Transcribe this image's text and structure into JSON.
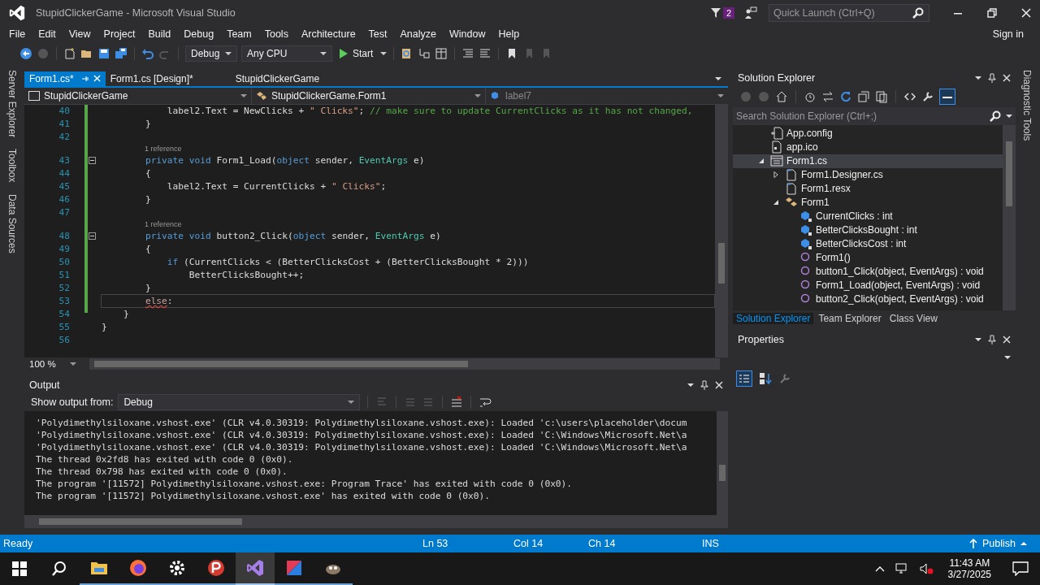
{
  "window": {
    "title": "StupidClickerGame - Microsoft Visual Studio"
  },
  "notifications": {
    "count": "2"
  },
  "quick_launch": {
    "placeholder": "Quick Launch (Ctrl+Q)"
  },
  "menu": [
    "File",
    "Edit",
    "View",
    "Project",
    "Build",
    "Debug",
    "Team",
    "Tools",
    "Architecture",
    "Test",
    "Analyze",
    "Window",
    "Help"
  ],
  "account": {
    "label": "Sign in"
  },
  "toolbar": {
    "configuration": "Debug",
    "platform": "Any CPU",
    "start": "Start"
  },
  "side_tabs_left": [
    "Server Explorer",
    "Toolbox",
    "Data Sources"
  ],
  "side_tabs_right": [
    "Diagnostic Tools"
  ],
  "editor": {
    "tabs": [
      {
        "label": "Form1.cs*",
        "selected": true
      },
      {
        "label": "Form1.cs [Design]*",
        "selected": false
      },
      {
        "label": "StupidClickerGame",
        "selected": false
      }
    ],
    "nav": [
      "StupidClickerGame",
      "StupidClickerGame.Form1",
      "label7"
    ],
    "lines": [
      {
        "kind": "code",
        "number": "40",
        "current": false,
        "code": [
          {
            "kind": "plain",
            "text": "            label2.Text = NewClicks + "
          },
          {
            "kind": "str",
            "text": "\" Clicks\""
          },
          {
            "kind": "plain",
            "text": "; "
          },
          {
            "kind": "comment",
            "text": "// make sure to update CurrentClicks as it has not changed,"
          }
        ]
      },
      {
        "kind": "code",
        "number": "41",
        "current": false,
        "code": [
          {
            "kind": "plain",
            "text": "        }"
          }
        ]
      },
      {
        "kind": "code",
        "number": "42",
        "current": false
      },
      {
        "kind": "lens",
        "text": "1 reference"
      },
      {
        "kind": "code",
        "number": "43",
        "current": false,
        "collapsible": true,
        "code": [
          {
            "kind": "kw",
            "text": "        private void"
          },
          {
            "kind": "plain",
            "text": " Form1_Load("
          },
          {
            "kind": "kw",
            "text": "object"
          },
          {
            "kind": "plain",
            "text": " sender, "
          },
          {
            "kind": "type",
            "text": "EventArgs"
          },
          {
            "kind": "plain",
            "text": " e)"
          }
        ]
      },
      {
        "kind": "code",
        "number": "44",
        "current": false,
        "code": [
          {
            "kind": "plain",
            "text": "        {"
          }
        ]
      },
      {
        "kind": "code",
        "number": "45",
        "current": false,
        "code": [
          {
            "kind": "plain",
            "text": "            label2.Text = CurrentClicks + "
          },
          {
            "kind": "str",
            "text": "\" Clicks\""
          },
          {
            "kind": "plain",
            "text": ";"
          }
        ]
      },
      {
        "kind": "code",
        "number": "46",
        "current": false,
        "code": [
          {
            "kind": "plain",
            "text": "        }"
          }
        ]
      },
      {
        "kind": "code",
        "number": "47",
        "current": false
      },
      {
        "kind": "lens",
        "text": "1 reference"
      },
      {
        "kind": "code",
        "number": "48",
        "current": false,
        "collapsible": true,
        "code": [
          {
            "kind": "kw",
            "text": "        private void"
          },
          {
            "kind": "plain",
            "text": " button2_Click("
          },
          {
            "kind": "kw",
            "text": "object"
          },
          {
            "kind": "plain",
            "text": " sender, "
          },
          {
            "kind": "type",
            "text": "EventArgs"
          },
          {
            "kind": "plain",
            "text": " e)"
          }
        ]
      },
      {
        "kind": "code",
        "number": "49",
        "current": false,
        "code": [
          {
            "kind": "plain",
            "text": "        {"
          }
        ]
      },
      {
        "kind": "code",
        "number": "50",
        "current": false,
        "code": [
          {
            "kind": "kw",
            "text": "            if"
          },
          {
            "kind": "plain",
            "text": " (CurrentClicks < (BetterClicksCost + (BetterClicksBought * 2)))"
          }
        ]
      },
      {
        "kind": "code",
        "number": "51",
        "current": false,
        "code": [
          {
            "kind": "plain",
            "text": "                BetterClicksBought++;"
          }
        ]
      },
      {
        "kind": "code",
        "number": "52",
        "current": false,
        "code": [
          {
            "kind": "plain",
            "text": "        }"
          }
        ]
      },
      {
        "kind": "code",
        "number": "53",
        "current": true,
        "code": [
          {
            "kind": "error",
            "text": "        else"
          },
          {
            "kind": "plain",
            "text": ":"
          }
        ]
      },
      {
        "kind": "code",
        "number": "54",
        "current": false,
        "code": [
          {
            "kind": "plain",
            "text": "    }"
          }
        ]
      },
      {
        "kind": "code",
        "number": "55",
        "current": false,
        "code": [
          {
            "kind": "plain",
            "text": "}"
          }
        ]
      },
      {
        "kind": "code",
        "number": "56",
        "current": false
      }
    ],
    "zoom": "100 %"
  },
  "output": {
    "title": "Output",
    "show_from_label": "Show output from:",
    "source": "Debug",
    "lines": [
      "'Polydimethylsiloxane.vshost.exe' (CLR v4.0.30319: Polydimethylsiloxane.vshost.exe): Loaded 'c:\\users\\placeholder\\docum",
      "'Polydimethylsiloxane.vshost.exe' (CLR v4.0.30319: Polydimethylsiloxane.vshost.exe): Loaded 'C:\\Windows\\Microsoft.Net\\a",
      "'Polydimethylsiloxane.vshost.exe' (CLR v4.0.30319: Polydimethylsiloxane.vshost.exe): Loaded 'C:\\Windows\\Microsoft.Net\\a",
      "The thread 0x2fd8 has exited with code 0 (0x0).",
      "The thread 0x798 has exited with code 0 (0x0).",
      "The program '[11572] Polydimethylsiloxane.vshost.exe: Program Trace' has exited with code 0 (0x0).",
      "The program '[11572] Polydimethylsiloxane.vshost.exe' has exited with code 0 (0x0)."
    ]
  },
  "solution_explorer": {
    "title": "Solution Explorer",
    "search": {
      "placeholder": "Search Solution Explorer (Ctrl+;)"
    },
    "tree": [
      {
        "label": "App.config",
        "kind": "config",
        "selected": false
      },
      {
        "label": "app.ico",
        "kind": "image",
        "selected": false
      },
      {
        "label": "Form1.cs",
        "kind": "form",
        "selected": true,
        "expanded": true,
        "children": [
          {
            "label": "Form1.Designer.cs",
            "kind": "file",
            "selected": false,
            "expanded": false
          },
          {
            "label": "Form1.resx",
            "kind": "file",
            "selected": false
          },
          {
            "label": "Form1",
            "kind": "class",
            "selected": false,
            "expanded": true,
            "children": [
              {
                "label": "CurrentClicks : int",
                "kind": "field",
                "selected": false
              },
              {
                "label": "BetterClicksBought : int",
                "kind": "field",
                "selected": false
              },
              {
                "label": "BetterClicksCost : int",
                "kind": "field",
                "selected": false
              },
              {
                "label": "Form1()",
                "kind": "method",
                "selected": false
              },
              {
                "label": "button1_Click(object, EventArgs) : void",
                "kind": "method",
                "selected": false
              },
              {
                "label": "Form1_Load(object, EventArgs) : void",
                "kind": "method",
                "selected": false
              },
              {
                "label": "button2_Click(object, EventArgs) : void",
                "kind": "method",
                "selected": false
              }
            ]
          }
        ]
      }
    ],
    "tabs": [
      {
        "label": "Solution Explorer",
        "selected": true
      },
      {
        "label": "Team Explorer",
        "selected": false
      },
      {
        "label": "Class View",
        "selected": false
      }
    ]
  },
  "properties": {
    "title": "Properties"
  },
  "status_bar": {
    "text": "Ready",
    "line": "Ln 53",
    "column": "Col 14",
    "char": "Ch 14",
    "mode": "INS",
    "publish": "Publish"
  },
  "taskbar": {
    "apps": [
      {
        "kind": "folder",
        "selected": false
      },
      {
        "kind": "browser",
        "selected": false
      },
      {
        "kind": "gear",
        "selected": false
      },
      {
        "kind": "red",
        "selected": false
      },
      {
        "kind": "vs",
        "selected": true
      },
      {
        "kind": "ide",
        "selected": false
      },
      {
        "kind": "animal",
        "selected": false
      }
    ],
    "time": "11:43 AM",
    "date": "3/27/2025"
  }
}
